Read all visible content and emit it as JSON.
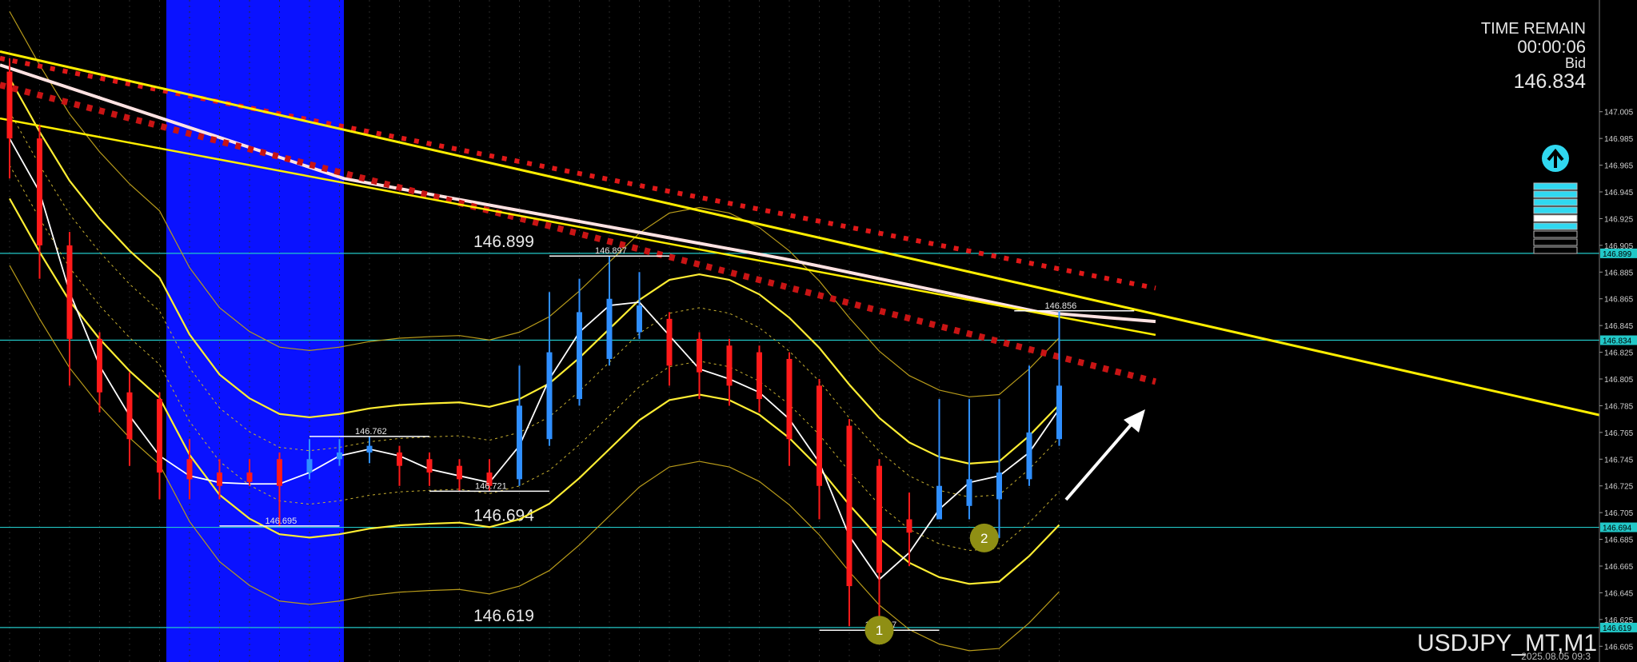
{
  "hud": {
    "time_remain_label": "TIME REMAIN",
    "time_remain_value": "00:00:06",
    "bid_label": "Bid",
    "bid_value": "146.834"
  },
  "symbol": "USDJPY_MT,M1",
  "timestamp": "2025.08.05 09:3",
  "colors": {
    "background": "#000000",
    "bull_candle": "#2f8fff",
    "bear_candle": "#ff1a1a",
    "envelope": "#ffee33",
    "trendline": "#ffee00",
    "slow_ma": "#ffe2e2",
    "fast_ma": "#ffffff",
    "level_line": "#22c8c8",
    "highlight_band": "#0a12ff",
    "marker": "#8f8f14",
    "gauge": "#30d8f0"
  },
  "chart_data": {
    "type": "candlestick",
    "symbol": "USDJPY_MT,M1",
    "ylim": [
      146.598,
      147.085
    ],
    "price_ticks": [
      147.005,
      146.985,
      146.965,
      146.945,
      146.925,
      146.905,
      146.885,
      146.865,
      146.845,
      146.825,
      146.805,
      146.785,
      146.765,
      146.745,
      146.725,
      146.705,
      146.685,
      146.665,
      146.645,
      146.625,
      146.605
    ],
    "price_ticks_shown": [
      "147.005",
      "146.985",
      "146.965",
      "146.945",
      "146.925",
      "146.905",
      "146.885",
      "146.865",
      "146.845",
      "146.825",
      "146.805",
      "146.785",
      "146.765",
      "146.745",
      "146.725",
      "146.705",
      "146.685",
      "146.665",
      "146.645",
      "146.625",
      "146.605"
    ],
    "highlight_levels": [
      {
        "value": 146.899,
        "label": "146.899"
      },
      {
        "value": 146.834,
        "label": "146.834"
      },
      {
        "value": 146.694,
        "label": "146.694"
      },
      {
        "value": 146.619,
        "label": "146.619"
      }
    ],
    "level_texts": [
      {
        "value": 146.899,
        "text": "146.899",
        "bar_index": 16
      },
      {
        "value": 146.694,
        "text": "146.694",
        "bar_index": 16
      },
      {
        "value": 146.619,
        "text": "146.619",
        "bar_index": 16
      }
    ],
    "swing_labels": [
      {
        "price": 146.762,
        "text": "146.762",
        "bar_index": 12,
        "from": 10,
        "to": 14
      },
      {
        "price": 146.695,
        "text": "146.695",
        "bar_index": 9,
        "from": 7,
        "to": 11
      },
      {
        "price": 146.721,
        "text": "146.721",
        "bar_index": 16,
        "from": 14,
        "to": 18
      },
      {
        "price": 146.897,
        "text": "146.897",
        "bar_index": 20,
        "from": 18,
        "to": 22
      },
      {
        "price": 146.617,
        "text": "146.617",
        "bar_index": 29,
        "from": 27,
        "to": 31
      },
      {
        "price": 146.856,
        "text": "146.856",
        "bar_index": 35,
        "from": 33.5,
        "to": 37.5
      }
    ],
    "markers": [
      {
        "text": "1",
        "bar_index": 29,
        "price": 146.617
      },
      {
        "text": "2",
        "bar_index": 32.5,
        "price": 146.686
      }
    ],
    "candles": [
      {
        "o": 147.035,
        "h": 147.045,
        "l": 146.955,
        "c": 146.985
      },
      {
        "o": 146.985,
        "h": 146.995,
        "l": 146.88,
        "c": 146.905
      },
      {
        "o": 146.905,
        "h": 146.915,
        "l": 146.8,
        "c": 146.835
      },
      {
        "o": 146.835,
        "h": 146.84,
        "l": 146.78,
        "c": 146.795
      },
      {
        "o": 146.795,
        "h": 146.81,
        "l": 146.74,
        "c": 146.76
      },
      {
        "o": 146.79,
        "h": 146.795,
        "l": 146.715,
        "c": 146.735
      },
      {
        "o": 146.745,
        "h": 146.76,
        "l": 146.715,
        "c": 146.73
      },
      {
        "o": 146.735,
        "h": 146.745,
        "l": 146.715,
        "c": 146.725
      },
      {
        "o": 146.735,
        "h": 146.745,
        "l": 146.725,
        "c": 146.728
      },
      {
        "o": 146.745,
        "h": 146.75,
        "l": 146.695,
        "c": 146.725
      },
      {
        "o": 146.735,
        "h": 146.76,
        "l": 146.73,
        "c": 146.745
      },
      {
        "o": 146.745,
        "h": 146.76,
        "l": 146.74,
        "c": 146.75
      },
      {
        "o": 146.75,
        "h": 146.762,
        "l": 146.742,
        "c": 146.755
      },
      {
        "o": 146.75,
        "h": 146.755,
        "l": 146.725,
        "c": 146.74
      },
      {
        "o": 146.745,
        "h": 146.75,
        "l": 146.725,
        "c": 146.735
      },
      {
        "o": 146.74,
        "h": 146.745,
        "l": 146.721,
        "c": 146.73
      },
      {
        "o": 146.735,
        "h": 146.745,
        "l": 146.721,
        "c": 146.725
      },
      {
        "o": 146.73,
        "h": 146.815,
        "l": 146.725,
        "c": 146.785
      },
      {
        "o": 146.76,
        "h": 146.87,
        "l": 146.755,
        "c": 146.825
      },
      {
        "o": 146.79,
        "h": 146.88,
        "l": 146.785,
        "c": 146.855
      },
      {
        "o": 146.82,
        "h": 146.897,
        "l": 146.815,
        "c": 146.865
      },
      {
        "o": 146.84,
        "h": 146.885,
        "l": 146.835,
        "c": 146.86
      },
      {
        "o": 146.85,
        "h": 146.855,
        "l": 146.8,
        "c": 146.815
      },
      {
        "o": 146.835,
        "h": 146.84,
        "l": 146.79,
        "c": 146.81
      },
      {
        "o": 146.83,
        "h": 146.835,
        "l": 146.785,
        "c": 146.8
      },
      {
        "o": 146.825,
        "h": 146.83,
        "l": 146.78,
        "c": 146.79
      },
      {
        "o": 146.82,
        "h": 146.825,
        "l": 146.74,
        "c": 146.76
      },
      {
        "o": 146.8,
        "h": 146.805,
        "l": 146.7,
        "c": 146.725
      },
      {
        "o": 146.77,
        "h": 146.775,
        "l": 146.62,
        "c": 146.65
      },
      {
        "o": 146.74,
        "h": 146.745,
        "l": 146.617,
        "c": 146.66
      },
      {
        "o": 146.7,
        "h": 146.72,
        "l": 146.665,
        "c": 146.69
      },
      {
        "o": 146.7,
        "h": 146.79,
        "l": 146.7,
        "c": 146.725
      },
      {
        "o": 146.71,
        "h": 146.79,
        "l": 146.7,
        "c": 146.73
      },
      {
        "o": 146.715,
        "h": 146.79,
        "l": 146.686,
        "c": 146.735
      },
      {
        "o": 146.73,
        "h": 146.815,
        "l": 146.725,
        "c": 146.765
      },
      {
        "o": 146.76,
        "h": 146.856,
        "l": 146.755,
        "c": 146.8
      }
    ]
  }
}
